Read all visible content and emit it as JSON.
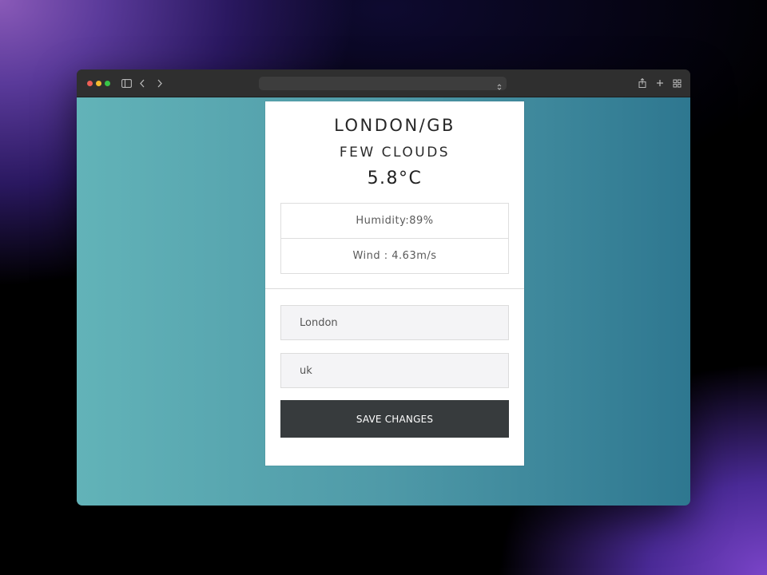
{
  "browser": {
    "url": ""
  },
  "weather": {
    "location": "LONDON/GB",
    "description": "FEW CLOUDS",
    "temperature": "5.8°C",
    "humidity": "Humidity:89%",
    "wind": "Wind : 4.63m/s"
  },
  "form": {
    "city_value": "London",
    "country_value": "uk",
    "save_label": "SAVE CHANGES"
  },
  "colors": {
    "accent_button": "#373b3d",
    "background_left": "#62b3b8",
    "background_right": "#2e7790"
  }
}
